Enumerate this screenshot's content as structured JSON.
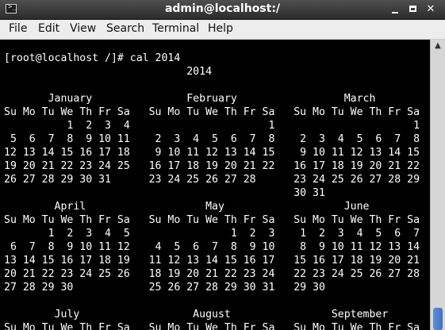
{
  "window": {
    "title": "admin@localhost:/",
    "icon": "terminal-icon",
    "icon_glyph": ">_",
    "controls": {
      "minimize": "",
      "maximize": "",
      "close": "✕"
    }
  },
  "menu": [
    "File",
    "Edit",
    "View",
    "Search",
    "Terminal",
    "Help"
  ],
  "terminal": {
    "text": "[root@localhost /]# cal 2014\n                             2014\n\n       January               February                 March\nSu Mo Tu We Th Fr Sa   Su Mo Tu We Th Fr Sa   Su Mo Tu We Th Fr Sa\n          1  2  3  4                      1                      1\n 5  6  7  8  9 10 11    2  3  4  5  6  7  8    2  3  4  5  6  7  8\n12 13 14 15 16 17 18    9 10 11 12 13 14 15    9 10 11 12 13 14 15\n19 20 21 22 23 24 25   16 17 18 19 20 21 22   16 17 18 19 20 21 22\n26 27 28 29 30 31      23 24 25 26 27 28      23 24 25 26 27 28 29\n                                              30 31\n        April                   May                   June\nSu Mo Tu We Th Fr Sa   Su Mo Tu We Th Fr Sa   Su Mo Tu We Th Fr Sa\n       1  2  3  4  5                1  2  3    1  2  3  4  5  6  7\n 6  7  8  9 10 11 12    4  5  6  7  8  9 10    8  9 10 11 12 13 14\n13 14 15 16 17 18 19   11 12 13 14 15 16 17   15 16 17 18 19 20 21\n20 21 22 23 24 25 26   18 19 20 21 22 23 24   22 23 24 25 26 27 28\n27 28 29 30            25 26 27 28 29 30 31   29 30\n\n        July                  August                September\nSu Mo Tu We Th Fr Sa   Su Mo Tu We Th Fr Sa   Su Mo Tu We Th Fr Sa"
  },
  "scrollbar": {
    "up_arrow": "▲"
  }
}
